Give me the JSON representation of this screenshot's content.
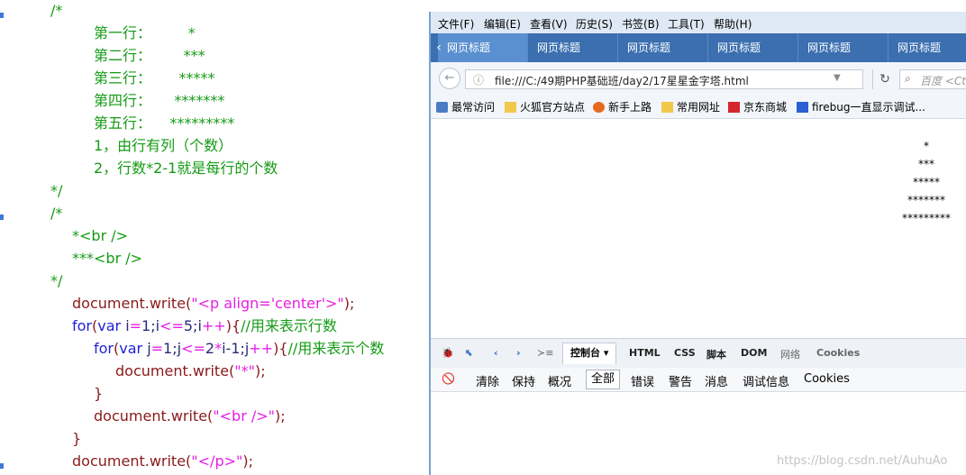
{
  "editor": {
    "lines": [
      {
        "segs": [
          {
            "c": "cm",
            "t": "/*"
          }
        ]
      },
      {
        "segs": [
          {
            "c": "cm",
            "t": "第一行：        *"
          }
        ]
      },
      {
        "segs": [
          {
            "c": "cm",
            "t": "第二行：       ***"
          }
        ]
      },
      {
        "segs": [
          {
            "c": "cm",
            "t": "第三行：      *****"
          }
        ]
      },
      {
        "segs": [
          {
            "c": "cm",
            "t": "第四行：     *******"
          }
        ]
      },
      {
        "segs": [
          {
            "c": "cm",
            "t": "第五行：    *********"
          }
        ]
      },
      {
        "segs": [
          {
            "c": "cm",
            "t": "1，由行有列（个数）"
          }
        ]
      },
      {
        "segs": [
          {
            "c": "cm",
            "t": "2，行数*2-1就是每行的个数"
          }
        ]
      },
      {
        "segs": [
          {
            "c": "cm",
            "t": "*/"
          }
        ]
      },
      {
        "segs": [
          {
            "c": "cm",
            "t": "/*"
          }
        ]
      },
      {
        "segs": [
          {
            "c": "cm",
            "t": "*<br />"
          }
        ]
      },
      {
        "segs": [
          {
            "c": "cm",
            "t": "***<br />"
          }
        ]
      },
      {
        "segs": [
          {
            "c": "cm",
            "t": "*/"
          }
        ]
      },
      {
        "segs": [
          {
            "c": "fn",
            "t": "document.write("
          },
          {
            "c": "str",
            "t": "\"<p align='center'>\""
          },
          {
            "c": "fn",
            "t": ");"
          }
        ]
      },
      {
        "segs": [
          {
            "c": "kw",
            "t": "for"
          },
          {
            "c": "fn",
            "t": "("
          },
          {
            "c": "kw",
            "t": "var "
          },
          {
            "c": "plain",
            "t": "i"
          },
          {
            "c": "op",
            "t": "="
          },
          {
            "c": "plain",
            "t": "1;i"
          },
          {
            "c": "op",
            "t": "<="
          },
          {
            "c": "plain",
            "t": "5;i"
          },
          {
            "c": "op",
            "t": "++"
          },
          {
            "c": "fn",
            "t": "){"
          },
          {
            "c": "cm",
            "t": "//用来表示行数"
          }
        ]
      },
      {
        "segs": [
          {
            "c": "kw",
            "t": "for"
          },
          {
            "c": "fn",
            "t": "("
          },
          {
            "c": "kw",
            "t": "var "
          },
          {
            "c": "plain",
            "t": "j"
          },
          {
            "c": "op",
            "t": "="
          },
          {
            "c": "plain",
            "t": "1;j"
          },
          {
            "c": "op",
            "t": "<="
          },
          {
            "c": "plain",
            "t": "2"
          },
          {
            "c": "op",
            "t": "*"
          },
          {
            "c": "plain",
            "t": "i-1;j"
          },
          {
            "c": "op",
            "t": "++"
          },
          {
            "c": "fn",
            "t": "){"
          },
          {
            "c": "cm",
            "t": "//用来表示个数"
          }
        ]
      },
      {
        "segs": [
          {
            "c": "fn",
            "t": "document.write("
          },
          {
            "c": "str",
            "t": "\"*\""
          },
          {
            "c": "fn",
            "t": ");"
          }
        ]
      },
      {
        "segs": [
          {
            "c": "fn",
            "t": "}"
          }
        ]
      },
      {
        "segs": [
          {
            "c": "fn",
            "t": "document.write("
          },
          {
            "c": "str",
            "t": "\"<br />\""
          },
          {
            "c": "fn",
            "t": ");"
          }
        ]
      },
      {
        "segs": [
          {
            "c": "fn",
            "t": "}"
          }
        ]
      },
      {
        "segs": [
          {
            "c": "fn",
            "t": "document.write("
          },
          {
            "c": "str",
            "t": "\"</p>\""
          },
          {
            "c": "fn",
            "t": ");"
          }
        ]
      }
    ]
  },
  "browser": {
    "menu": [
      "文件(F)",
      "编辑(E)",
      "查看(V)",
      "历史(S)",
      "书签(B)",
      "工具(T)",
      "帮助(H)"
    ],
    "tabs": [
      "网页标题",
      "网页标题",
      "网页标题",
      "网页标题",
      "网页标题",
      "网页标题"
    ],
    "url": "file:///C:/49期PHP基础班/day2/17星星金字塔.html",
    "search_placeholder": "百度 <Ctrl",
    "bookmarks": [
      "最常访问",
      "火狐官方站点",
      "新手上路",
      "常用网址",
      "京东商城",
      "firebug一直显示调试..."
    ],
    "page_lines": [
      "*",
      "***",
      "*****",
      "*******",
      "*********"
    ],
    "firebug_tabs": [
      "控制台 ▾",
      "HTML",
      "CSS",
      "脚本",
      "DOM",
      "网络",
      "Cookies"
    ],
    "firebug_sub": [
      "清除",
      "保持",
      "概况",
      "全部",
      "错误",
      "警告",
      "消息",
      "调试信息",
      "Cookies"
    ],
    "watermark": "https://blog.csdn.net/AuhuAo"
  }
}
